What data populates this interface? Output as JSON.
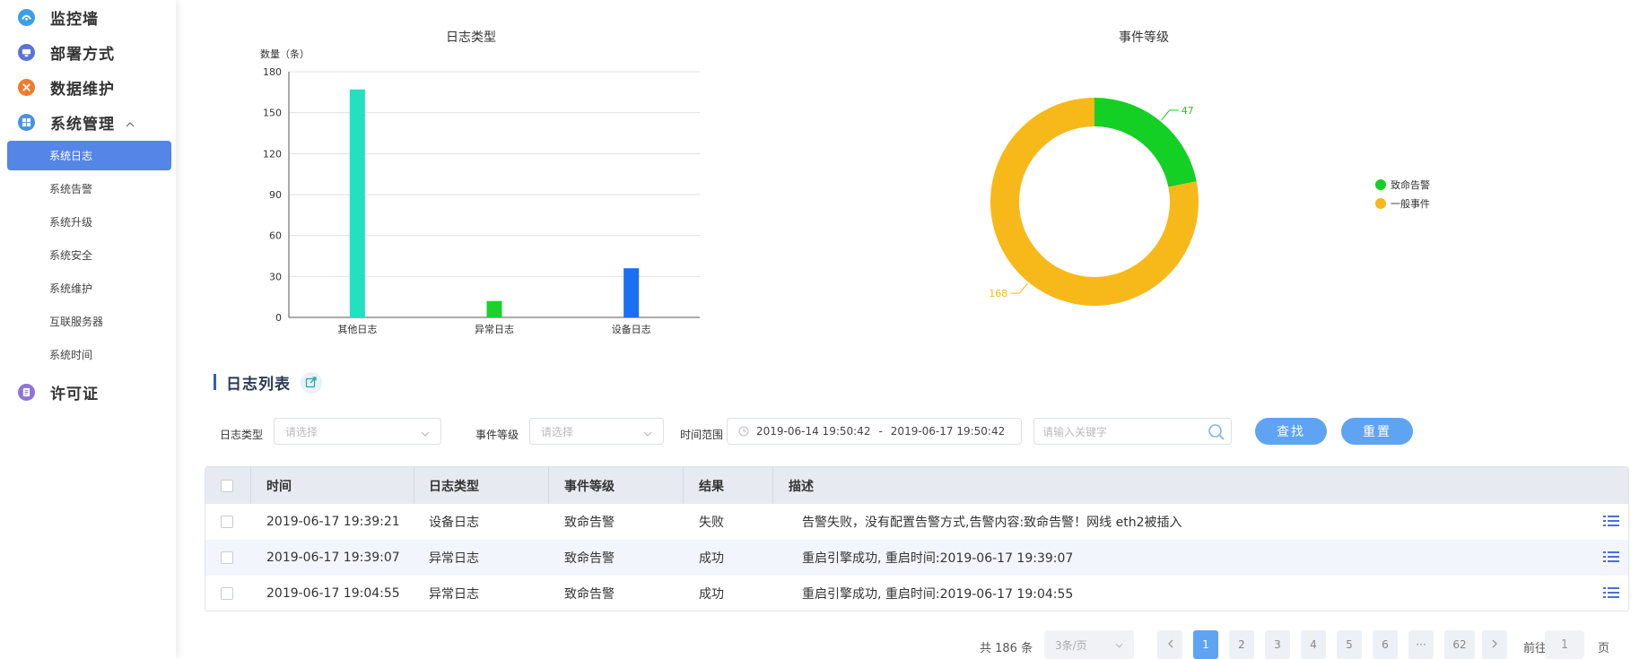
{
  "sidebar": {
    "main_items": [
      {
        "label": "监控墙",
        "icon": "monitor-icon",
        "color": "#3d9ee8"
      },
      {
        "label": "部署方式",
        "icon": "deploy-icon",
        "color": "#5a74d6"
      },
      {
        "label": "数据维护",
        "icon": "tools-icon",
        "color": "#f07b2b"
      },
      {
        "label": "系统管理",
        "icon": "windows-icon",
        "color": "#4a90e2"
      },
      {
        "label": "许可证",
        "icon": "license-icon",
        "color": "#8e74d9"
      }
    ],
    "sub_items": [
      "系统日志",
      "系统告警",
      "系统升级",
      "系统安全",
      "系统维护",
      "互联服务器",
      "系统时间"
    ],
    "active_sub": "系统日志",
    "accent": "#5585e6"
  },
  "charts": {
    "bar_title": "日志类型",
    "pie_title": "事件等级"
  },
  "chart_data": [
    {
      "type": "bar",
      "title": "日志类型",
      "ylabel": "数量（条）",
      "categories": [
        "其他日志",
        "异常日志",
        "设备日志"
      ],
      "values": [
        167,
        12,
        36
      ],
      "colors": [
        "#22e0c0",
        "#19d22b",
        "#1a6ff2"
      ],
      "ylim": [
        0,
        180
      ],
      "yticks": [
        0,
        30,
        60,
        90,
        120,
        150,
        180
      ],
      "grid": true
    },
    {
      "type": "pie",
      "title": "事件等级",
      "donut": true,
      "labels": [
        "致命告警",
        "一般事件"
      ],
      "values": [
        47,
        168
      ],
      "colors": [
        "#14cf24",
        "#f7b91a"
      ],
      "legend": "right"
    }
  ],
  "list": {
    "title": "日志列表",
    "filters": {
      "type_label": "日志类型",
      "type_placeholder": "请选择",
      "level_label": "事件等级",
      "level_placeholder": "请选择",
      "range_label": "时间范围",
      "range_start": "2019-06-14 19:50:42",
      "range_sep": "-",
      "range_end": "2019-06-17 19:50:42",
      "keyword_placeholder": "请输入关键字",
      "search_button": "查找",
      "reset_button": "重置"
    },
    "columns": [
      "时间",
      "日志类型",
      "事件等级",
      "结果",
      "描述"
    ],
    "rows": [
      {
        "time": "2019-06-17 19:39:21",
        "type": "设备日志",
        "level": "致命告警",
        "result": "失败",
        "desc": "告警失败，没有配置告警方式,告警内容:致命告警！网线 eth2被插入"
      },
      {
        "time": "2019-06-17 19:39:07",
        "type": "异常日志",
        "level": "致命告警",
        "result": "成功",
        "desc": "重启引擎成功, 重启时间:2019-06-17 19:39:07"
      },
      {
        "time": "2019-06-17 19:04:55",
        "type": "异常日志",
        "level": "致命告警",
        "result": "成功",
        "desc": "重启引擎成功, 重启时间:2019-06-17 19:04:55"
      }
    ]
  },
  "pagination": {
    "total": "共 186 条",
    "page_size": "3条/页",
    "pages": [
      "1",
      "2",
      "3",
      "4",
      "5",
      "6",
      "···",
      "62"
    ],
    "current": "1",
    "goto_prefix": "前往",
    "goto_value": "1",
    "goto_suffix": "页"
  }
}
